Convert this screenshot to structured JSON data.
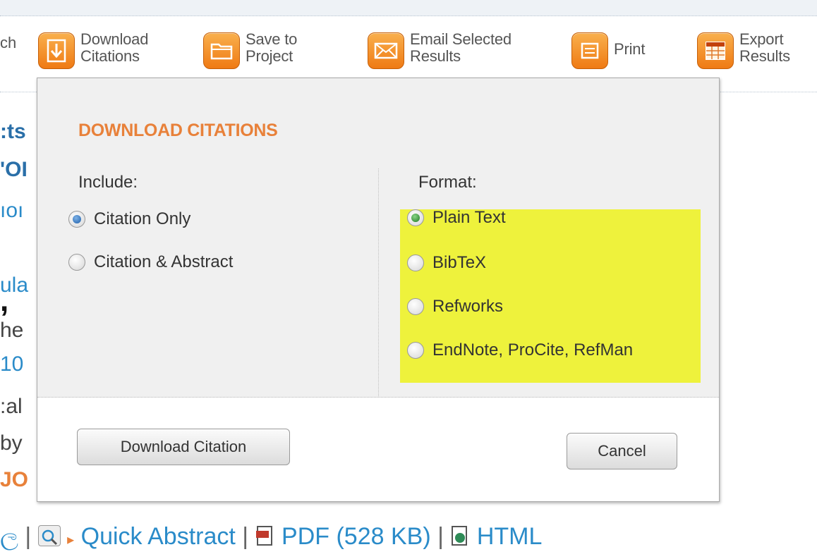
{
  "toolbar": {
    "partial_label": "ch",
    "items": [
      {
        "label": "Download\nCitations",
        "icon": "download-arrow-icon"
      },
      {
        "label": "Save to\nProject",
        "icon": "folder-icon"
      },
      {
        "label": "Email Selected\nResults",
        "icon": "envelope-icon"
      },
      {
        "label": "Print",
        "icon": "printer-icon"
      },
      {
        "label": "Export\nResults",
        "icon": "spreadsheet-icon"
      }
    ]
  },
  "background_text": {
    "fragments": [
      ":ts",
      "'OI",
      "ıoı",
      "ula",
      ",",
      "he",
      "10",
      ":al",
      "by",
      "JO"
    ]
  },
  "dialog": {
    "title": "DOWNLOAD CITATIONS",
    "include": {
      "label": "Include:",
      "options": [
        "Citation Only",
        "Citation & Abstract"
      ],
      "selected": "Citation Only"
    },
    "format": {
      "label": "Format:",
      "options": [
        "Plain Text",
        "BibTeX",
        "Refworks",
        "EndNote, ProCite, RefMan"
      ],
      "selected": "Plain Text",
      "highlight_color": "#eef23c"
    },
    "download_button": "Download Citation",
    "cancel_button": "Cancel"
  },
  "bottom_links": {
    "partial": "ල",
    "quick_abstract": "Quick Abstract",
    "pdf": "PDF (528 KB)",
    "html": "HTML"
  },
  "colors": {
    "accent_orange": "#e8813a",
    "link_blue": "#2a8bc9"
  }
}
